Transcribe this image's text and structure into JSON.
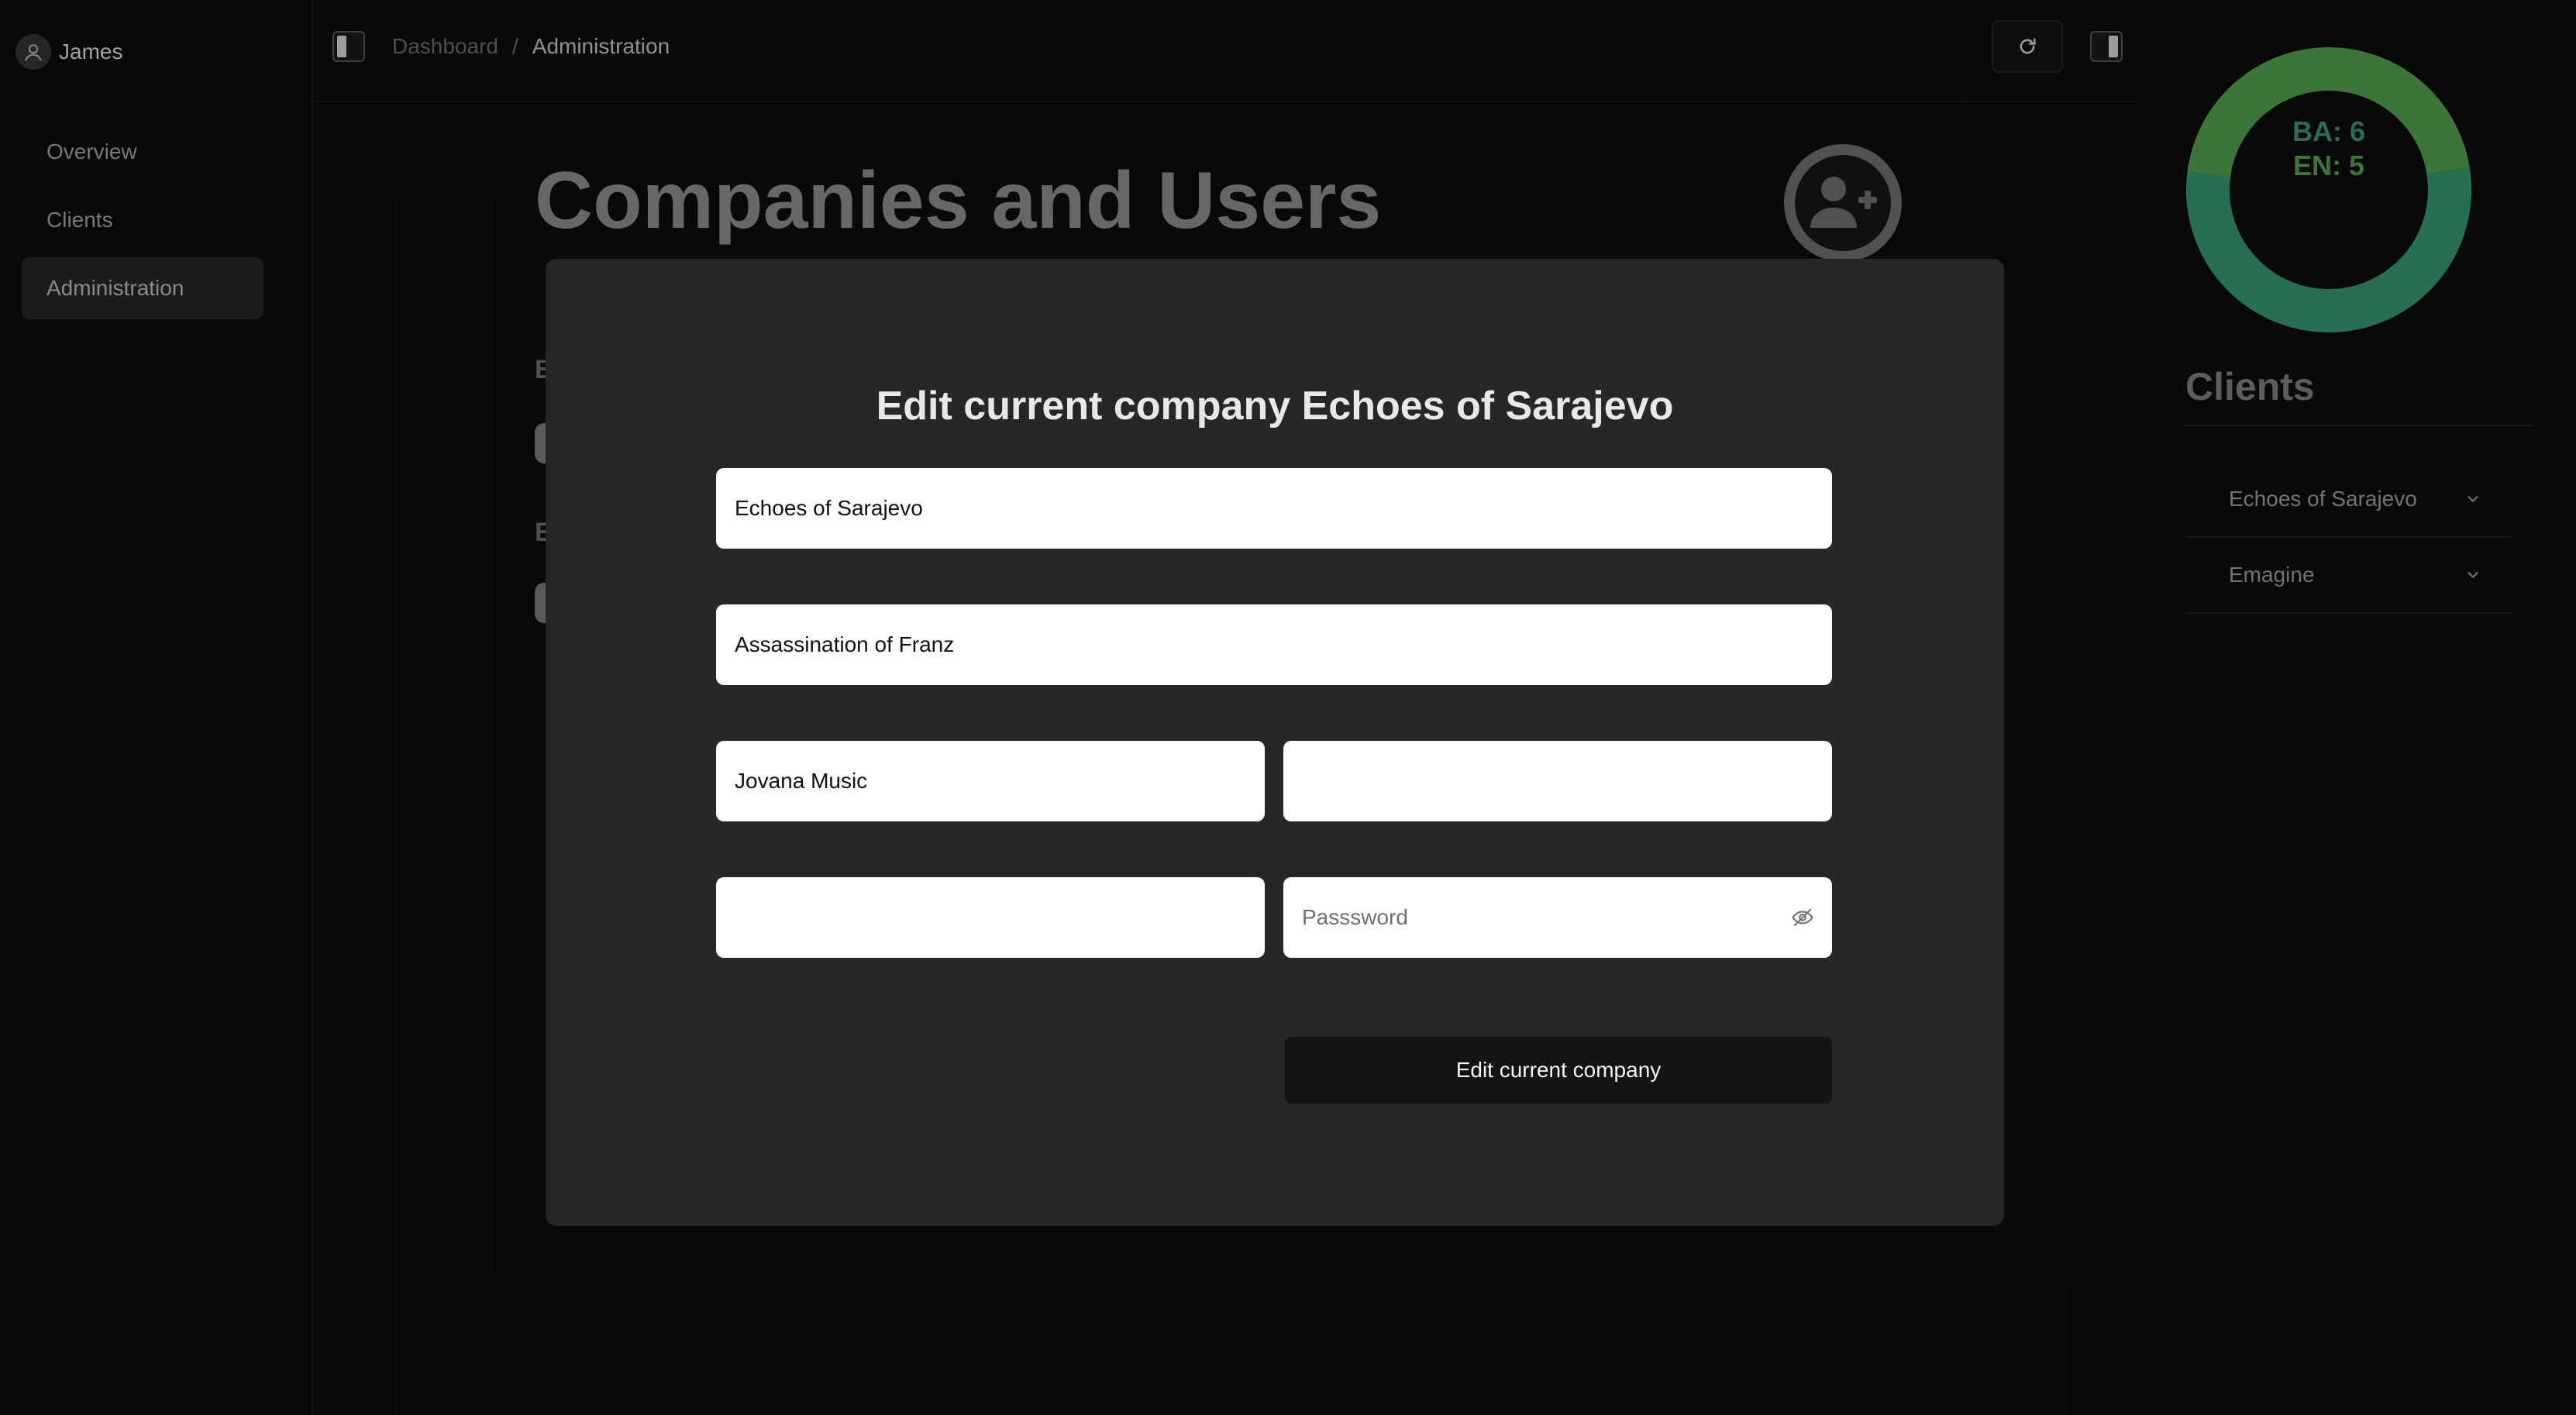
{
  "sidebar": {
    "user_name": "James",
    "items": [
      {
        "label": "Overview"
      },
      {
        "label": "Clients"
      },
      {
        "label": "Administration"
      }
    ],
    "active_index": 2
  },
  "topbar": {
    "breadcrumb": [
      {
        "label": "Dashboard"
      },
      {
        "label": "Administration"
      }
    ],
    "separator": "/",
    "icons": [
      "sidebar-toggle-icon",
      "refresh-icon",
      "panel-toggle-icon"
    ]
  },
  "main": {
    "title": "Companies and Users",
    "section_letters": [
      "E",
      "E"
    ],
    "add_user_icon": "user-plus-icon"
  },
  "right_panel": {
    "stats": {
      "ba": "BA: 6",
      "en": "EN: 5"
    },
    "title": "Clients",
    "clients": [
      {
        "name": "Echoes of Sarajevo"
      },
      {
        "name": "Emagine"
      }
    ]
  },
  "chart_data": {
    "type": "pie",
    "style": "donut",
    "categories": [
      "BA",
      "EN"
    ],
    "values": [
      6,
      5
    ],
    "colors": [
      "#34956f",
      "#4f9e4b"
    ],
    "labels": [
      "BA: 6",
      "EN: 5"
    ]
  },
  "modal": {
    "title": "Edit current company Echoes of Sarajevo",
    "fields": {
      "company_name": {
        "value": "Echoes of Sarajevo",
        "placeholder": ""
      },
      "description": {
        "value": "Assassination of Franz",
        "placeholder": ""
      },
      "contact": {
        "value": "Jovana Music",
        "placeholder": ""
      },
      "field_4": {
        "value": "",
        "placeholder": ""
      },
      "field_5": {
        "value": "",
        "placeholder": ""
      },
      "password": {
        "value": "",
        "placeholder": "Passsword"
      }
    },
    "submit_label": "Edit current company"
  },
  "colors": {
    "background": "#0d0d0d",
    "modal": "#272727",
    "donut_ba": "#34956f",
    "donut_en": "#4f9e4b",
    "input_bg": "#ffffff",
    "button_bg": "#141414"
  }
}
